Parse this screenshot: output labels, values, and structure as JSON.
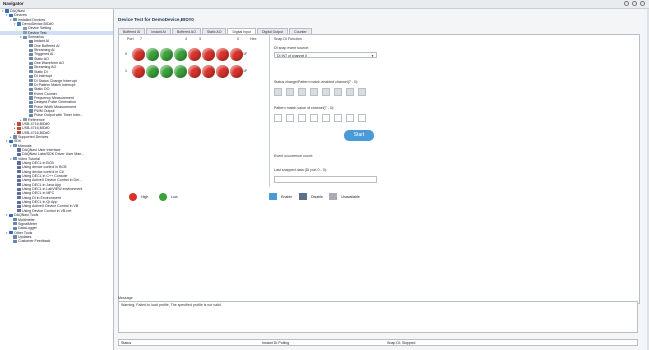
{
  "window": {
    "title": "Navigator"
  },
  "tree": [
    {
      "label": "DAQNavi",
      "exp": "▾",
      "color": "#2f6fbf"
    },
    {
      "label": "Devices",
      "exp": "▾",
      "color": "#2f6fbf"
    },
    {
      "label": "Installed Devices",
      "exp": "▾",
      "color": "#6f8fb0"
    },
    {
      "label": "DemoDevice,BID#0",
      "exp": "▾",
      "color": "#3a7fc8"
    },
    {
      "label": "Device Setting",
      "exp": "",
      "color": "#8a9bb0"
    },
    {
      "label": "Device Test",
      "exp": "",
      "color": "#8a9bb0",
      "selected": true
    },
    {
      "label": "Scenarios",
      "exp": "▾",
      "color": "#6f8fb0"
    },
    {
      "label": "Instant AI",
      "exp": "",
      "color": "#6a86a8"
    },
    {
      "label": "One Buffered AI",
      "exp": "",
      "color": "#6a86a8"
    },
    {
      "label": "Streaming AI",
      "exp": "",
      "color": "#6a86a8"
    },
    {
      "label": "Triggered AI",
      "exp": "",
      "color": "#6a86a8"
    },
    {
      "label": "Static AO",
      "exp": "",
      "color": "#6a86a8"
    },
    {
      "label": "One Waveform AO",
      "exp": "",
      "color": "#6a86a8"
    },
    {
      "label": "Streaming AO",
      "exp": "",
      "color": "#6a86a8"
    },
    {
      "label": "Static DI",
      "exp": "",
      "color": "#6a86a8"
    },
    {
      "label": "DI Interrupt",
      "exp": "",
      "color": "#6a86a8"
    },
    {
      "label": "DI Status Change Interrupt",
      "exp": "",
      "color": "#6a86a8"
    },
    {
      "label": "DI Pattern Match Interrupt",
      "exp": "",
      "color": "#6a86a8"
    },
    {
      "label": "Static DO",
      "exp": "",
      "color": "#6a86a8"
    },
    {
      "label": "Event Counter",
      "exp": "",
      "color": "#6a86a8"
    },
    {
      "label": "Frequency Measurement",
      "exp": "",
      "color": "#6a86a8"
    },
    {
      "label": "Delayed Pulse Generation",
      "exp": "",
      "color": "#6a86a8"
    },
    {
      "label": "Pulse Width Measurement",
      "exp": "",
      "color": "#6a86a8"
    },
    {
      "label": "PWM Output",
      "exp": "",
      "color": "#6a86a8"
    },
    {
      "label": "Pulse Output with Timer Inter...",
      "exp": "",
      "color": "#6a86a8"
    },
    {
      "label": "Reference",
      "exp": "▸",
      "color": "#8a9bb0"
    },
    {
      "label": "USB-4716,BID#0",
      "exp": "▸",
      "color": "#c04a3a"
    },
    {
      "label": "USB-4716,BID#0",
      "exp": "▸",
      "color": "#c04a3a"
    },
    {
      "label": "USB-4716,BID#0",
      "exp": "▸",
      "color": "#c04a3a"
    },
    {
      "label": "Supported Devices",
      "exp": "▸",
      "color": "#6f8fb0"
    },
    {
      "label": "SDK",
      "exp": "▾",
      "color": "#2f6fbf"
    },
    {
      "label": "Manuals",
      "exp": "▾",
      "color": "#6f8fb0"
    },
    {
      "label": "DAQNavi User Interface",
      "exp": "",
      "color": "#5a6fa0"
    },
    {
      "label": "DAQNavi Labs/SDK Driver User Man...",
      "exp": "",
      "color": "#5a6fa0"
    },
    {
      "label": "Video Tutorial",
      "exp": "▾",
      "color": "#6f8fb0"
    },
    {
      "label": "Using DECL in BCB",
      "exp": "",
      "color": "#5a6fa0"
    },
    {
      "label": "Using device control in BCB",
      "exp": "",
      "color": "#5a6fa0"
    },
    {
      "label": "Using device control in C#",
      "exp": "",
      "color": "#5a6fa0"
    },
    {
      "label": "Using DECL in C++ Console",
      "exp": "",
      "color": "#5a6fa0"
    },
    {
      "label": "Using ActiveX Device Control in Del...",
      "exp": "",
      "color": "#5a6fa0"
    },
    {
      "label": "Using DECL in Java App",
      "exp": "",
      "color": "#5a6fa0"
    },
    {
      "label": "Using DECL in LabVIEW environment",
      "exp": "",
      "color": "#5a6fa0"
    },
    {
      "label": "Using DECL in MFC",
      "exp": "",
      "color": "#5a6fa0"
    },
    {
      "label": "Using DI in Environment",
      "exp": "",
      "color": "#5a6fa0"
    },
    {
      "label": "Using DECL in Qt App",
      "exp": "",
      "color": "#5a6fa0"
    },
    {
      "label": "Using ActiveX Device Control in VB",
      "exp": "",
      "color": "#5a6fa0"
    },
    {
      "label": "Using Device Control in VB.net",
      "exp": "",
      "color": "#5a6fa0"
    },
    {
      "label": "DAQNavi Tools",
      "exp": "▾",
      "color": "#2f6fbf"
    },
    {
      "label": "Multimeter",
      "exp": "",
      "color": "#6a86a8"
    },
    {
      "label": "SignalMeter",
      "exp": "",
      "color": "#6a86a8"
    },
    {
      "label": "DataLogger",
      "exp": "",
      "color": "#6a86a8"
    },
    {
      "label": "Other Tools",
      "exp": "▾",
      "color": "#2f6fbf"
    },
    {
      "label": "Updates",
      "exp": "",
      "color": "#6a86a8"
    },
    {
      "label": "Customer Feedback",
      "exp": "",
      "color": "#6a86a8"
    }
  ],
  "page": {
    "title": "Device Test for DemoDevice,BID#0"
  },
  "tabs": [
    "Buffered AI",
    "Instant AI",
    "Buffered AO",
    "Static AO",
    "Digital Input",
    "Digital Output",
    "Counter"
  ],
  "active_tab": 4,
  "led_header": {
    "port": "Port",
    "bit7": "7",
    "bit4": "4",
    "bit3": "3",
    "bit0": "0",
    "hex": "Hex"
  },
  "ports": [
    {
      "port": "0",
      "hex": "1F",
      "levels": [
        "high",
        "low",
        "low",
        "low",
        "high",
        "high",
        "high",
        "high"
      ]
    },
    {
      "port": "1",
      "hex": "1F",
      "levels": [
        "high",
        "low",
        "low",
        "low",
        "high",
        "high",
        "high",
        "high"
      ]
    }
  ],
  "snap": {
    "group_label": "Snap DI Function",
    "source_label": "DI snap event source:",
    "source_value": "DI INT of channel 0",
    "change_label": "Status change/Pattern match enabled channel(7 - 0):",
    "pattern_label": "Pattern match value of channel(7 - 0):",
    "start_label": "Start",
    "count_label": "Event occurrence count:",
    "last_label": "Last snapped data (DI port 0 - 0):"
  },
  "legend": {
    "high": "High",
    "low": "Low",
    "enable": "Enable",
    "disable": "Disable",
    "unavailable": "Unavailable"
  },
  "message": {
    "header": "Message",
    "text": "Warning: Failed to load profile, The specified profile is not valid."
  },
  "status": {
    "label": "Status",
    "mode": "Instant DI Polling",
    "snap": "Snap DI: Stopped"
  },
  "colors": {
    "high": "#d8332a",
    "low": "#3ba23a",
    "enable": "#4a9ad8",
    "disable": "#5d6f8a",
    "unavailable": "#a9adb3"
  }
}
